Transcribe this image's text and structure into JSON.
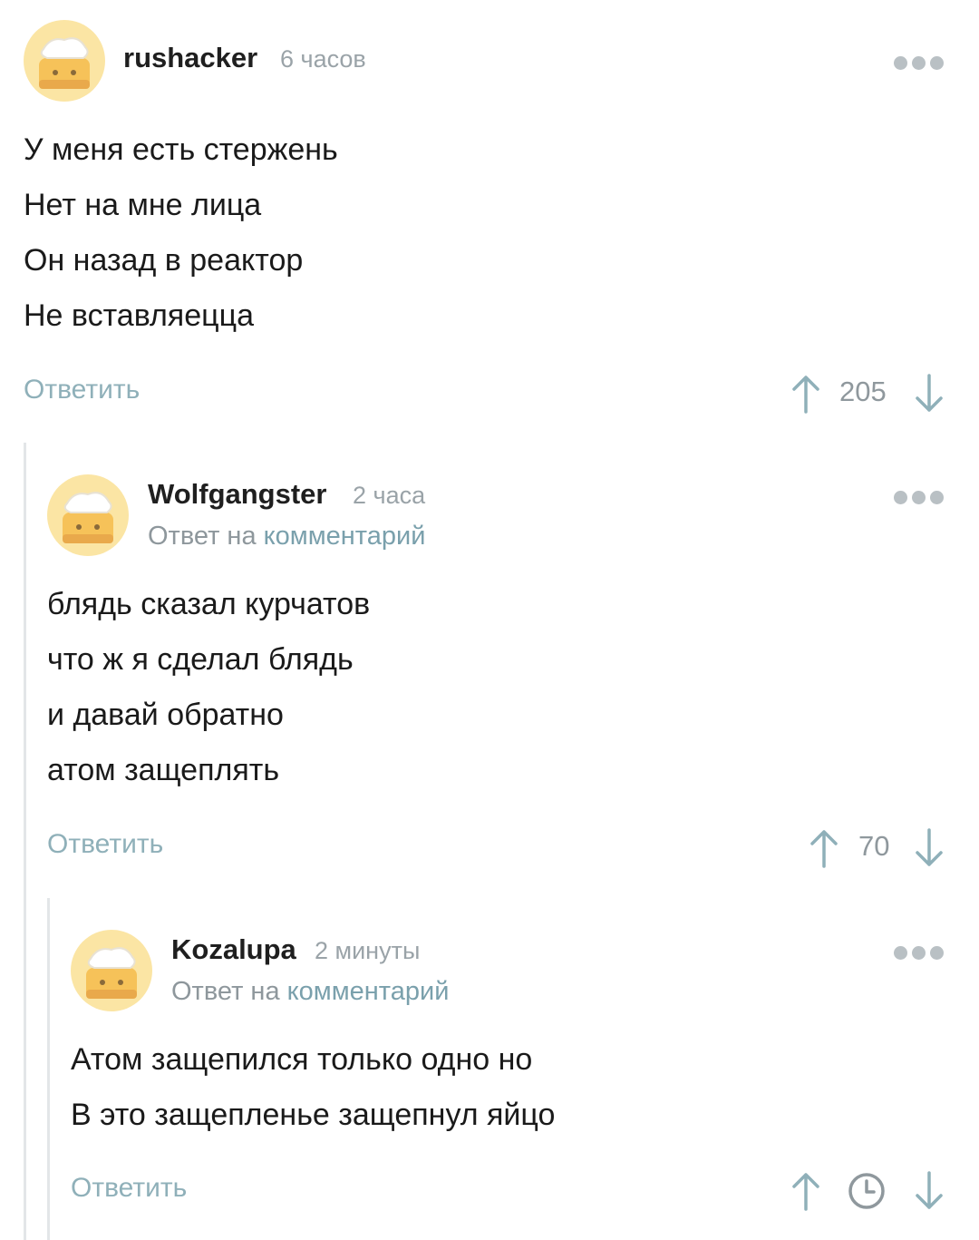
{
  "colors": {
    "accent": "#7aa0ac",
    "muted": "#9aa3a8",
    "thread_line": "#e3e6e8",
    "avatar_bg": "#fbe5a4"
  },
  "comments": [
    {
      "author": "rushacker",
      "time": "6 часов",
      "lines": [
        "У меня есть стержень",
        "Нет на мне лица",
        "Он назад в реактор",
        "Не вставляецца"
      ],
      "reply_label": "Ответить",
      "score": "205"
    },
    {
      "author": "Wolfgangster",
      "time": "2 часа",
      "reply_prefix": "Ответ на",
      "reply_link": "комментарий",
      "lines": [
        "блядь сказал курчатов",
        "что ж я сделал блядь",
        "и давай обратно",
        "атом защеплять"
      ],
      "reply_label": "Ответить",
      "score": "70"
    },
    {
      "author": "Kozalupa",
      "time": "2 минуты",
      "reply_prefix": "Ответ на",
      "reply_link": "комментарий",
      "lines": [
        "Атом защепился только одно но",
        "В это защепленье защепнул яйцо"
      ],
      "reply_label": "Ответить",
      "score_icon": "clock-icon"
    }
  ]
}
